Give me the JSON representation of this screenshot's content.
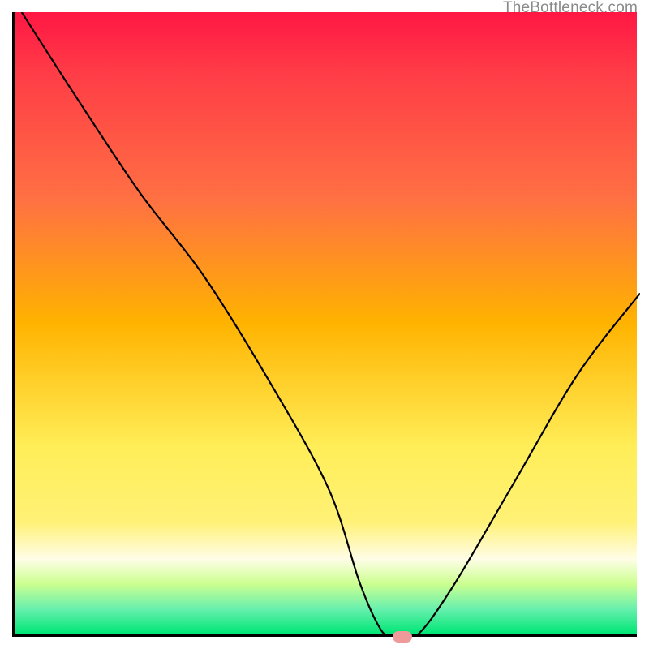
{
  "watermark": "TheBottleneck.com",
  "chart_data": {
    "type": "line",
    "title": "",
    "xlabel": "",
    "ylabel": "",
    "xlim": [
      0,
      100
    ],
    "ylim": [
      0,
      100
    ],
    "x": [
      1,
      10,
      20,
      30,
      40,
      50,
      55,
      58,
      60,
      64,
      70,
      80,
      90,
      100
    ],
    "values": [
      100,
      86,
      71,
      58,
      42,
      24,
      9,
      2,
      0,
      0,
      8,
      25,
      42,
      55
    ],
    "marker": {
      "x": 62,
      "y": 0
    },
    "background_gradient": {
      "top": "#ff1744",
      "mid": "#ffee58",
      "bottom": "#00e676"
    }
  }
}
